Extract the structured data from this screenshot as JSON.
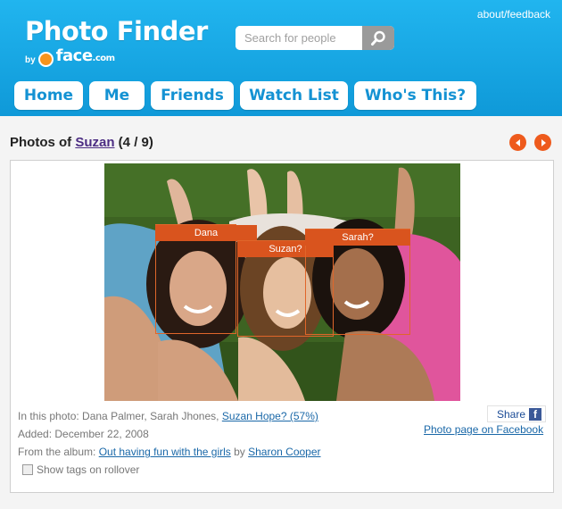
{
  "header": {
    "logo_text": "Photo Finder",
    "by_label": "by",
    "brand": "face",
    "brand_tld": ".com",
    "about_label": "about/feedback",
    "search_placeholder": "Search for people",
    "search_icon": "magnifier-icon"
  },
  "nav": {
    "items": [
      {
        "label": "Home"
      },
      {
        "label": "Me"
      },
      {
        "label": "Friends"
      },
      {
        "label": "Watch List"
      },
      {
        "label": "Who's This?"
      }
    ]
  },
  "content": {
    "title_prefix": "Photos of ",
    "person": "Suzan",
    "counter": " (4 / 9)",
    "prev_icon": "arrow-left-icon",
    "next_icon": "arrow-right-icon"
  },
  "tags": [
    {
      "label": "Dana"
    },
    {
      "label": "Suzan?"
    },
    {
      "label": "Sarah?"
    }
  ],
  "info": {
    "in_photo_prefix": "In this photo: Dana Palmer, Sarah Jhones, ",
    "in_photo_link": "Suzan Hope? (57%)",
    "added": "Added: December 22, 2008",
    "album_prefix": "From the album: ",
    "album_link": "Out having fun with the girls",
    "album_by": " by ",
    "album_owner": "Sharon Cooper",
    "rollover_label": "Show tags on rollover",
    "share_label": "Share",
    "fb_letter": "f",
    "fb_link": "Photo page on Facebook"
  },
  "colors": {
    "header": "#0f99d8",
    "nav_text": "#1492d3",
    "accent": "#ee5a1c",
    "tag": "#d9541e",
    "link": "#1a68a8"
  }
}
